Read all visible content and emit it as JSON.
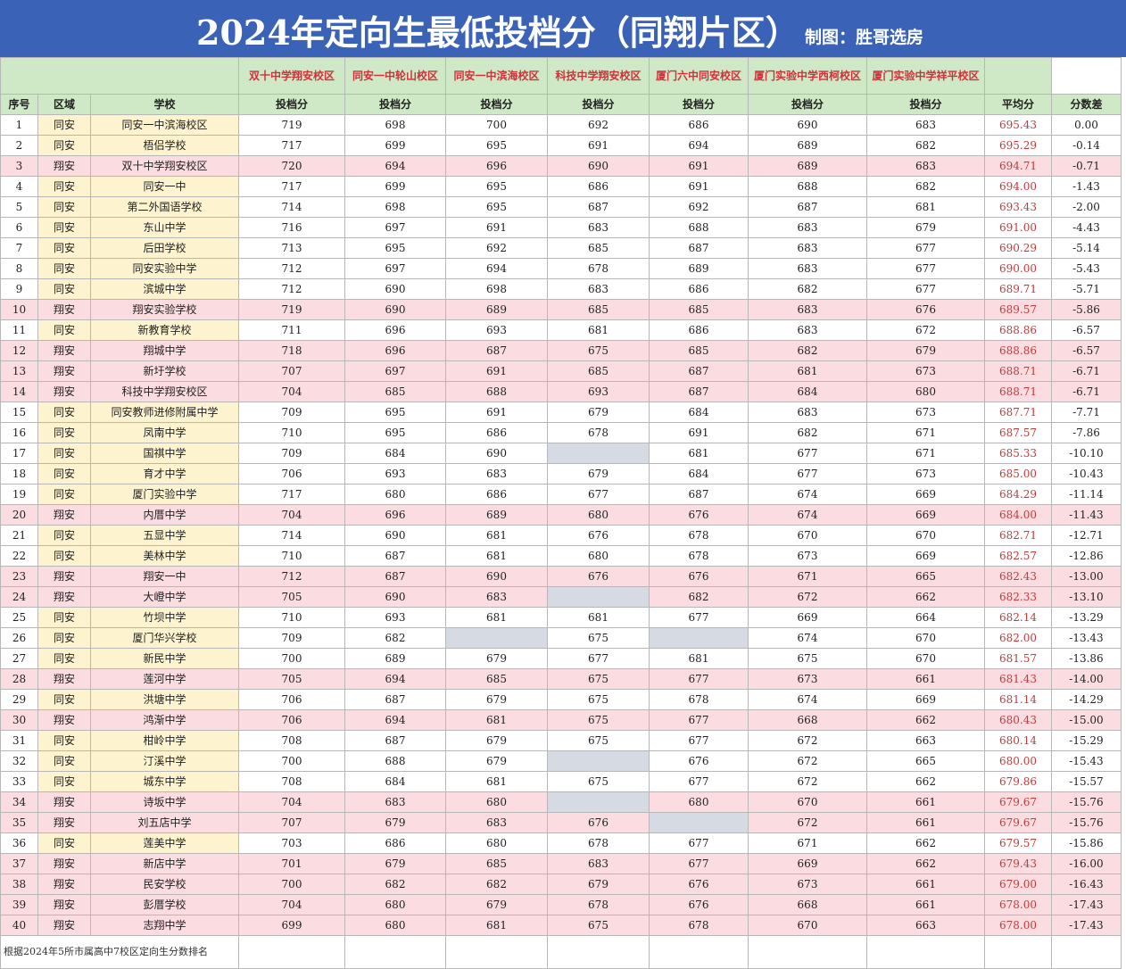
{
  "header": {
    "title": "2024年定向生最低投档分（同翔片区）",
    "credit": "制图：胜哥选房"
  },
  "campuses": [
    "双十中学翔安校区",
    "同安一中轮山校区",
    "同安一中滨海校区",
    "科技中学翔安校区",
    "厦门六中同安校区",
    "厦门实验中学西柯校区",
    "厦门实验中学祥平校区"
  ],
  "columns": {
    "index": "序号",
    "region": "区域",
    "school": "学校",
    "score": "投档分",
    "avg": "平均分",
    "diff": "分数差"
  },
  "rows": [
    {
      "n": "1",
      "region": "同安",
      "school": "同安一中滨海校区",
      "s": [
        "719",
        "698",
        "700",
        "692",
        "686",
        "690",
        "683"
      ],
      "avg": "695.43",
      "diff": "0.00"
    },
    {
      "n": "2",
      "region": "同安",
      "school": "梧侣学校",
      "s": [
        "717",
        "699",
        "695",
        "691",
        "694",
        "689",
        "682"
      ],
      "avg": "695.29",
      "diff": "-0.14"
    },
    {
      "n": "3",
      "region": "翔安",
      "school": "双十中学翔安校区",
      "s": [
        "720",
        "694",
        "696",
        "690",
        "691",
        "689",
        "683"
      ],
      "avg": "694.71",
      "diff": "-0.71"
    },
    {
      "n": "4",
      "region": "同安",
      "school": "同安一中",
      "s": [
        "717",
        "699",
        "695",
        "686",
        "691",
        "688",
        "682"
      ],
      "avg": "694.00",
      "diff": "-1.43"
    },
    {
      "n": "5",
      "region": "同安",
      "school": "第二外国语学校",
      "s": [
        "714",
        "698",
        "695",
        "687",
        "692",
        "687",
        "681"
      ],
      "avg": "693.43",
      "diff": "-2.00"
    },
    {
      "n": "6",
      "region": "同安",
      "school": "东山中学",
      "s": [
        "716",
        "697",
        "691",
        "683",
        "688",
        "683",
        "679"
      ],
      "avg": "691.00",
      "diff": "-4.43"
    },
    {
      "n": "7",
      "region": "同安",
      "school": "后田学校",
      "s": [
        "713",
        "695",
        "692",
        "685",
        "687",
        "683",
        "677"
      ],
      "avg": "690.29",
      "diff": "-5.14"
    },
    {
      "n": "8",
      "region": "同安",
      "school": "同安实验中学",
      "s": [
        "712",
        "697",
        "694",
        "678",
        "689",
        "683",
        "677"
      ],
      "avg": "690.00",
      "diff": "-5.43"
    },
    {
      "n": "9",
      "region": "同安",
      "school": "滨城中学",
      "s": [
        "712",
        "690",
        "698",
        "683",
        "686",
        "682",
        "677"
      ],
      "avg": "689.71",
      "diff": "-5.71"
    },
    {
      "n": "10",
      "region": "翔安",
      "school": "翔安实验学校",
      "s": [
        "719",
        "690",
        "689",
        "685",
        "685",
        "683",
        "676"
      ],
      "avg": "689.57",
      "diff": "-5.86"
    },
    {
      "n": "11",
      "region": "同安",
      "school": "新教育学校",
      "s": [
        "711",
        "696",
        "693",
        "681",
        "686",
        "683",
        "672"
      ],
      "avg": "688.86",
      "diff": "-6.57"
    },
    {
      "n": "12",
      "region": "翔安",
      "school": "翔城中学",
      "s": [
        "718",
        "696",
        "687",
        "675",
        "685",
        "682",
        "679"
      ],
      "avg": "688.86",
      "diff": "-6.57"
    },
    {
      "n": "13",
      "region": "翔安",
      "school": "新圩学校",
      "s": [
        "707",
        "697",
        "691",
        "685",
        "687",
        "681",
        "673"
      ],
      "avg": "688.71",
      "diff": "-6.71"
    },
    {
      "n": "14",
      "region": "翔安",
      "school": "科技中学翔安校区",
      "s": [
        "704",
        "685",
        "688",
        "693",
        "687",
        "684",
        "680"
      ],
      "avg": "688.71",
      "diff": "-6.71"
    },
    {
      "n": "15",
      "region": "同安",
      "school": "同安教师进修附属中学",
      "s": [
        "709",
        "695",
        "691",
        "679",
        "684",
        "683",
        "673"
      ],
      "avg": "687.71",
      "diff": "-7.71"
    },
    {
      "n": "16",
      "region": "同安",
      "school": "凤南中学",
      "s": [
        "710",
        "695",
        "686",
        "678",
        "691",
        "682",
        "671"
      ],
      "avg": "687.57",
      "diff": "-7.86"
    },
    {
      "n": "17",
      "region": "同安",
      "school": "国祺中学",
      "s": [
        "709",
        "684",
        "690",
        "",
        "681",
        "677",
        "671"
      ],
      "avg": "685.33",
      "diff": "-10.10"
    },
    {
      "n": "18",
      "region": "同安",
      "school": "育才中学",
      "s": [
        "706",
        "693",
        "683",
        "679",
        "684",
        "677",
        "673"
      ],
      "avg": "685.00",
      "diff": "-10.43"
    },
    {
      "n": "19",
      "region": "同安",
      "school": "厦门实验中学",
      "s": [
        "717",
        "680",
        "686",
        "677",
        "687",
        "674",
        "669"
      ],
      "avg": "684.29",
      "diff": "-11.14"
    },
    {
      "n": "20",
      "region": "翔安",
      "school": "内厝中学",
      "s": [
        "704",
        "696",
        "689",
        "680",
        "676",
        "674",
        "669"
      ],
      "avg": "684.00",
      "diff": "-11.43"
    },
    {
      "n": "21",
      "region": "同安",
      "school": "五显中学",
      "s": [
        "714",
        "690",
        "681",
        "676",
        "678",
        "670",
        "670"
      ],
      "avg": "682.71",
      "diff": "-12.71"
    },
    {
      "n": "22",
      "region": "同安",
      "school": "美林中学",
      "s": [
        "710",
        "687",
        "681",
        "680",
        "678",
        "673",
        "669"
      ],
      "avg": "682.57",
      "diff": "-12.86"
    },
    {
      "n": "23",
      "region": "翔安",
      "school": "翔安一中",
      "s": [
        "712",
        "687",
        "690",
        "676",
        "676",
        "671",
        "665"
      ],
      "avg": "682.43",
      "diff": "-13.00"
    },
    {
      "n": "24",
      "region": "翔安",
      "school": "大嶝中学",
      "s": [
        "705",
        "690",
        "683",
        "",
        "682",
        "672",
        "662"
      ],
      "avg": "682.33",
      "diff": "-13.10"
    },
    {
      "n": "25",
      "region": "同安",
      "school": "竹坝中学",
      "s": [
        "710",
        "693",
        "681",
        "681",
        "677",
        "669",
        "664"
      ],
      "avg": "682.14",
      "diff": "-13.29"
    },
    {
      "n": "26",
      "region": "同安",
      "school": "厦门华兴学校",
      "s": [
        "709",
        "682",
        "",
        "675",
        "",
        "674",
        "670"
      ],
      "avg": "682.00",
      "diff": "-13.43"
    },
    {
      "n": "27",
      "region": "同安",
      "school": "新民中学",
      "s": [
        "700",
        "689",
        "679",
        "677",
        "681",
        "675",
        "670"
      ],
      "avg": "681.57",
      "diff": "-13.86"
    },
    {
      "n": "28",
      "region": "翔安",
      "school": "莲河中学",
      "s": [
        "705",
        "694",
        "685",
        "675",
        "677",
        "673",
        "661"
      ],
      "avg": "681.43",
      "diff": "-14.00"
    },
    {
      "n": "29",
      "region": "同安",
      "school": "洪塘中学",
      "s": [
        "706",
        "687",
        "679",
        "675",
        "678",
        "674",
        "669"
      ],
      "avg": "681.14",
      "diff": "-14.29"
    },
    {
      "n": "30",
      "region": "翔安",
      "school": "鸿渐中学",
      "s": [
        "706",
        "694",
        "681",
        "675",
        "677",
        "668",
        "662"
      ],
      "avg": "680.43",
      "diff": "-15.00"
    },
    {
      "n": "31",
      "region": "同安",
      "school": "柑岭中学",
      "s": [
        "708",
        "687",
        "679",
        "675",
        "677",
        "672",
        "663"
      ],
      "avg": "680.14",
      "diff": "-15.29"
    },
    {
      "n": "32",
      "region": "同安",
      "school": "汀溪中学",
      "s": [
        "700",
        "688",
        "679",
        "",
        "676",
        "672",
        "665"
      ],
      "avg": "680.00",
      "diff": "-15.43"
    },
    {
      "n": "33",
      "region": "同安",
      "school": "城东中学",
      "s": [
        "708",
        "684",
        "681",
        "675",
        "677",
        "672",
        "662"
      ],
      "avg": "679.86",
      "diff": "-15.57"
    },
    {
      "n": "34",
      "region": "翔安",
      "school": "诗坂中学",
      "s": [
        "704",
        "683",
        "680",
        "",
        "680",
        "670",
        "661"
      ],
      "avg": "679.67",
      "diff": "-15.76"
    },
    {
      "n": "35",
      "region": "翔安",
      "school": "刘五店中学",
      "s": [
        "707",
        "679",
        "683",
        "676",
        "",
        "672",
        "661"
      ],
      "avg": "679.67",
      "diff": "-15.76"
    },
    {
      "n": "36",
      "region": "同安",
      "school": "莲美中学",
      "s": [
        "703",
        "686",
        "680",
        "678",
        "677",
        "671",
        "662"
      ],
      "avg": "679.57",
      "diff": "-15.86"
    },
    {
      "n": "37",
      "region": "翔安",
      "school": "新店中学",
      "s": [
        "701",
        "679",
        "685",
        "683",
        "677",
        "669",
        "662"
      ],
      "avg": "679.43",
      "diff": "-16.00"
    },
    {
      "n": "38",
      "region": "翔安",
      "school": "民安学校",
      "s": [
        "700",
        "682",
        "682",
        "679",
        "676",
        "673",
        "661"
      ],
      "avg": "679.00",
      "diff": "-16.43"
    },
    {
      "n": "39",
      "region": "翔安",
      "school": "彭厝学校",
      "s": [
        "704",
        "680",
        "679",
        "678",
        "676",
        "668",
        "661"
      ],
      "avg": "678.00",
      "diff": "-17.43"
    },
    {
      "n": "40",
      "region": "翔安",
      "school": "志翔中学",
      "s": [
        "699",
        "680",
        "681",
        "675",
        "678",
        "670",
        "663"
      ],
      "avg": "678.00",
      "diff": "-17.43"
    }
  ],
  "footnote": "根据2024年5所市属高中7校区定向生分数排名"
}
